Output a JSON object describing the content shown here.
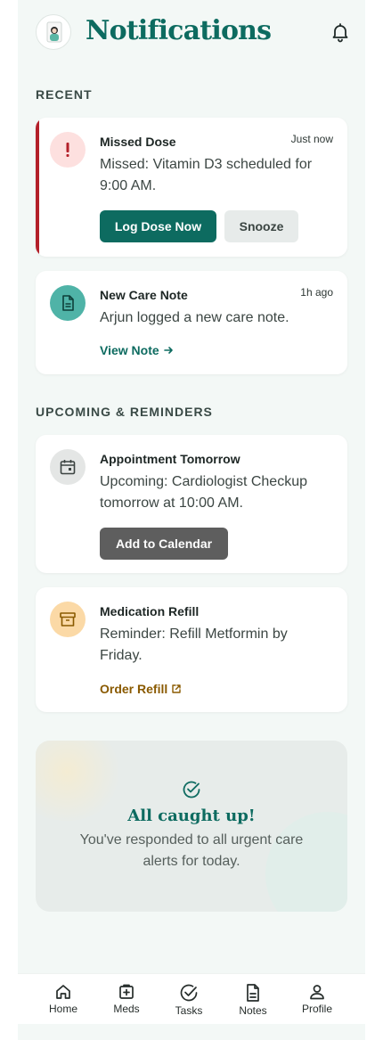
{
  "header": {
    "title": "Notifications"
  },
  "sections": {
    "recent": "RECENT",
    "upcoming": "UPCOMING & REMINDERS"
  },
  "missed_dose": {
    "title": "Missed Dose",
    "time": "Just now",
    "body": "Missed: Vitamin D3 scheduled for 9:00 AM.",
    "primary_button": "Log Dose Now",
    "secondary_button": "Snooze"
  },
  "care_note": {
    "title": "New Care Note",
    "time": "1h ago",
    "body": "Arjun logged a new care note.",
    "link": "View Note"
  },
  "appointment": {
    "title": "Appointment Tomorrow",
    "body": "Upcoming: Cardiologist Checkup tomorrow at 10:00 AM.",
    "button": "Add to Calendar"
  },
  "refill": {
    "title": "Medication Refill",
    "body": "Reminder: Refill Metformin by Friday.",
    "link": "Order Refill"
  },
  "caught_up": {
    "title": "All caught up!",
    "body": "You've responded to all urgent care alerts for today."
  },
  "nav": [
    {
      "label": "Home",
      "icon": "home-icon"
    },
    {
      "label": "Meds",
      "icon": "medkit-icon"
    },
    {
      "label": "Tasks",
      "icon": "check-circle-icon"
    },
    {
      "label": "Notes",
      "icon": "document-icon"
    },
    {
      "label": "Profile",
      "icon": "user-icon"
    }
  ],
  "colors": {
    "brand": "#0d6b60",
    "urgent": "#b3202a",
    "refill_link": "#8a5a00",
    "background": "#f3f8f6"
  }
}
